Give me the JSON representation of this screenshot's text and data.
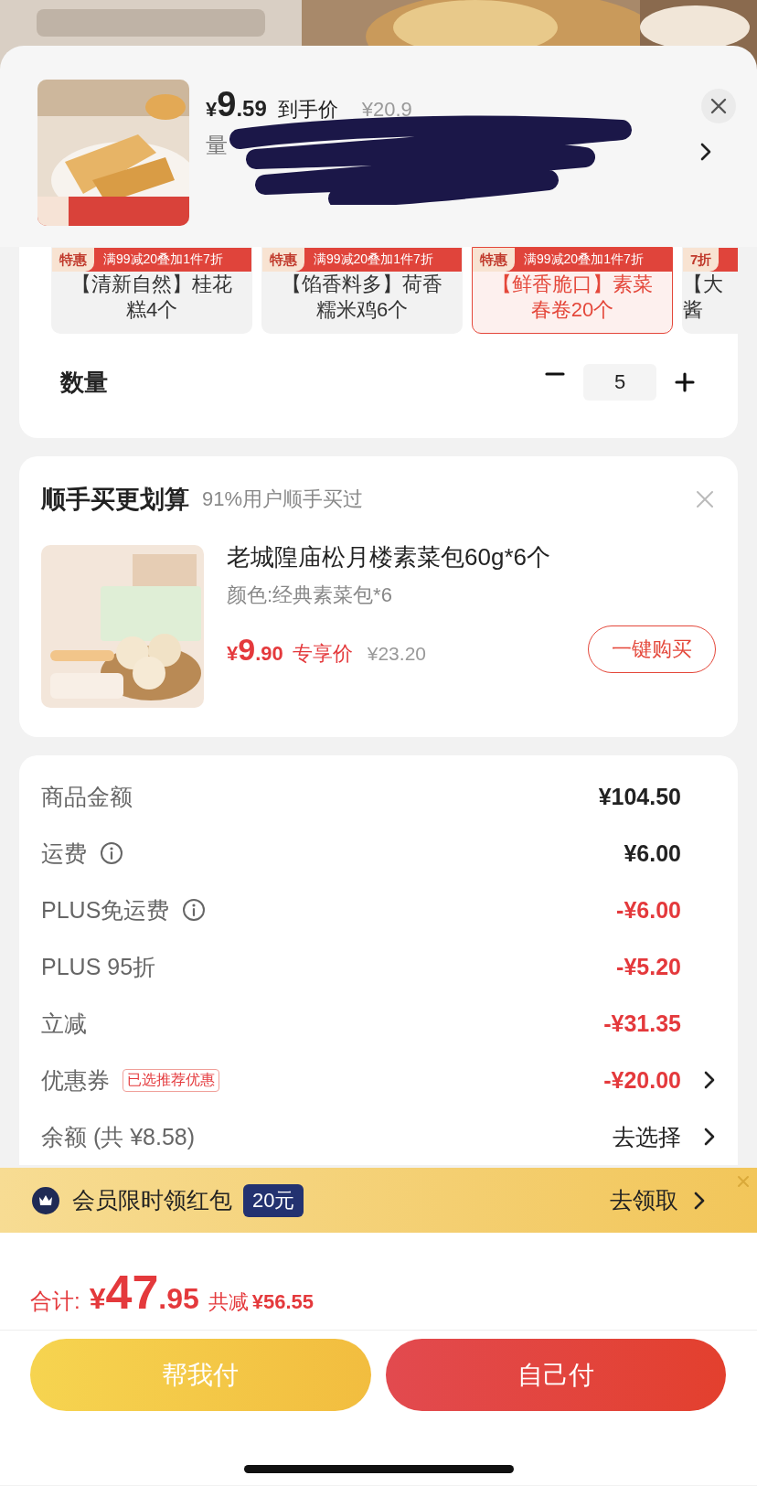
{
  "header": {
    "price_symbol": "¥",
    "price_int": "9",
    "price_dec": ".59",
    "price_label": "到手价",
    "original_price": "¥20.9",
    "spec": "量"
  },
  "variants": [
    {
      "tag": "特惠",
      "promo": "满99减20叠加1件7折",
      "lines": [
        "【清新自然】桂花",
        "糕4个"
      ],
      "selected": false
    },
    {
      "tag": "特惠",
      "promo": "满99减20叠加1件7折",
      "lines": [
        "【馅香料多】荷香",
        "糯米鸡6个"
      ],
      "selected": false
    },
    {
      "tag": "特惠",
      "promo": "满99减20叠加1件7折",
      "lines": [
        "【鲜香脆口】素菜",
        "春卷20个"
      ],
      "selected": true
    },
    {
      "tag": "7折",
      "lines": [
        "【大",
        "酱"
      ],
      "selected": false
    }
  ],
  "quantity": {
    "label": "数量",
    "value": "5"
  },
  "addon": {
    "title": "顺手买更划算",
    "subtitle": "91%用户顺手买过",
    "product": {
      "name": "老城隍庙松月楼素菜包60g*6个",
      "spec": "颜色:经典素菜包*6",
      "price_symbol": "¥",
      "price_int": "9",
      "price_dec": ".90",
      "price_label": "专享价",
      "original_price": "¥23.20",
      "button": "一键购买"
    }
  },
  "costs": [
    {
      "kind": "amount",
      "label": "商品金额",
      "value": "¥104.50",
      "discount": false,
      "info": false,
      "chevron": false
    },
    {
      "kind": "amount",
      "label": "运费",
      "value": "¥6.00",
      "discount": false,
      "info": true,
      "chevron": false
    },
    {
      "kind": "amount",
      "label": "PLUS免运费",
      "value": "-¥6.00",
      "discount": true,
      "info": true,
      "chevron": false
    },
    {
      "kind": "amount",
      "label": "PLUS 95折",
      "value": "-¥5.20",
      "discount": true,
      "info": false,
      "chevron": false
    },
    {
      "kind": "amount",
      "label": "立减",
      "value": "-¥31.35",
      "discount": true,
      "info": false,
      "chevron": false
    },
    {
      "kind": "amount",
      "label": "优惠券",
      "badge": "已选推荐优惠",
      "value": "-¥20.00",
      "discount": true,
      "info": false,
      "chevron": true
    },
    {
      "kind": "link",
      "label": "余额 (共 ¥8.58)",
      "value": "去选择",
      "discount": false,
      "info": false,
      "chevron": true
    }
  ],
  "member_banner": {
    "text": "会员限时领红包",
    "badge": "20元",
    "action": "去领取"
  },
  "total": {
    "label": "合计:",
    "symbol": "¥",
    "int": "47",
    "dec": ".95",
    "saved_label": "共减",
    "saved": "¥56.55"
  },
  "buttons": [
    {
      "label": "帮我付",
      "kind": "secondary"
    },
    {
      "label": "自己付",
      "kind": "primary"
    }
  ]
}
